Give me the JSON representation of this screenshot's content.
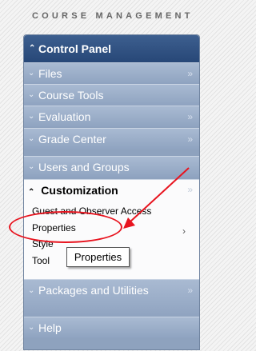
{
  "heading": "COURSE MANAGEMENT",
  "control_panel": {
    "label": "Control Panel"
  },
  "menu": {
    "files": "Files",
    "course_tools": "Course Tools",
    "evaluation": "Evaluation",
    "grade_center": "Grade Center",
    "users_and_groups": "Users and Groups",
    "customization": "Customization",
    "packages_and_utilities": "Packages and Utilities",
    "help": "Help"
  },
  "customization_items": {
    "guest_access": "Guest and Observer Access",
    "properties": "Properties",
    "style": "Style",
    "tool": "Tool"
  },
  "tooltip": "Properties",
  "icons": {
    "expand": "chevron-double-down-icon",
    "collapse": "chevron-double-up-icon",
    "flyout": "double-right-arrow-icon",
    "submenu": "right-arrow-icon"
  },
  "colors": {
    "header": "#274777",
    "row": "#8fa3c0",
    "annotation": "#e8141f"
  }
}
